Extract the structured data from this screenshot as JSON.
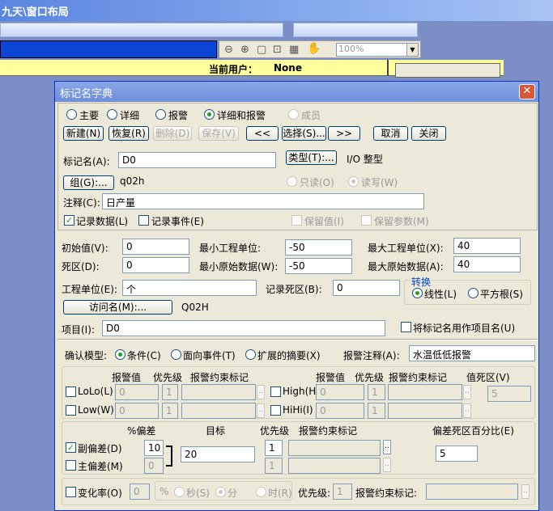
{
  "window": {
    "title": "九天\\窗口布局"
  },
  "toolbar": {
    "zoom": "100%"
  },
  "status": {
    "user_label": "当前用户：",
    "user_value": "None"
  },
  "dialog": {
    "title": "标记名字典",
    "modes": [
      "主要",
      "详细",
      "报警",
      "详细和报警",
      "成员"
    ],
    "buttons": {
      "new": "新建(N)",
      "restore": "恢复(R)",
      "delete": "删除(D)",
      "save": "保存(V)",
      "prev": "<<",
      "select": "选择(S)...",
      "next": ">>",
      "cancel": "取消",
      "close": "关闭"
    },
    "tag": {
      "label": "标记名(A):",
      "value": "D0",
      "type_button": "类型(T):...",
      "type_value": "I/O 整型",
      "group_button": "组(G):...",
      "group_value": "q02h",
      "readonly": "只读(O)",
      "readwrite": "读写(W)",
      "comment_label": "注释(C):",
      "comment_value": "日产量",
      "record_data": "记录数据(L)",
      "record_event": "记录事件(E)",
      "keep_value": "保留值(I)",
      "keep_param": "保留参数(M)"
    },
    "detail": {
      "init_label": "初始值(V):",
      "init_value": "0",
      "minEU_label": "最小工程单位:",
      "minEU_value": "-50",
      "maxEU_label": "最大工程单位(X):",
      "maxEU_value": "40",
      "dead_label": "死区(D):",
      "dead_value": "0",
      "minRaw_label": "最小原始数据(W):",
      "minRaw_value": "-50",
      "maxRaw_label": "最大原始数据(A):",
      "maxRaw_value": "40",
      "unit_label": "工程单位(E):",
      "unit_value": "个",
      "recdead_label": "记录死区(B):",
      "recdead_value": "0",
      "conv_title": "转换",
      "linear": "线性(L)",
      "sqrt": "平方根(S)",
      "access_button": "访问名(M):...",
      "access_value": "Q02H",
      "item_label": "项目(I):",
      "item_value": "D0",
      "use_tag": "将标记名用作项目名(U)"
    },
    "alarm": {
      "confirm_label": "确认模型:",
      "cond": "条件(C)",
      "event": "面向事件(T)",
      "ext": "扩展的摘要(X)",
      "comment_label": "报警注释(A):",
      "comment_value": "水温低低报警",
      "col_alarm": "报警值",
      "col_prio": "优先级",
      "col_tag": "报警约束标记",
      "col_dead": "值死区(V)",
      "lolo": "LoLo(L)",
      "low": "Low(W)",
      "high": "High(H)",
      "hihi": "HiHi(I)",
      "zero": "0",
      "one": "1",
      "five": "5",
      "dev_pct": "%偏差",
      "dev_target": "目标",
      "dev_prio": "优先级",
      "dev_tag": "报警约束标记",
      "dev_deadpct": "偏差死区百分比(E)",
      "minor_dev": "副偏差(D)",
      "minor_val": "10",
      "target_val": "20",
      "major_dev": "主偏差(M)",
      "major_val": "0",
      "dev_dead_val": "5",
      "rate": "变化率(O)",
      "rate_val": "0",
      "percent": "%",
      "sec": "秒(S)",
      "min": "分",
      "hour": "时(R)",
      "rate_prio_label": "优先级:",
      "rate_prio": "1",
      "rate_tag_label": "报警约束标记:"
    }
  }
}
